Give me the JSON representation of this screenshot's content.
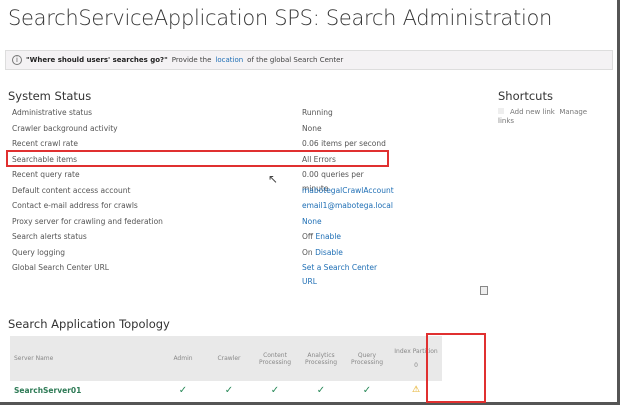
{
  "title": "SearchServiceApplication SPS: Search Administration",
  "info": {
    "icon": "info-icon",
    "question": "\"Where should users' searches go?\"",
    "pre": "Provide the",
    "link": "location",
    "post": "of the global Search Center"
  },
  "system_status": {
    "heading": "System Status",
    "rows": [
      {
        "label": "Administrative status",
        "value": "Running"
      },
      {
        "label": "Crawler background activity",
        "value": "None"
      },
      {
        "label": "Recent crawl rate",
        "value": "0.06 items per second"
      },
      {
        "label": "Searchable items",
        "value": "All Errors"
      },
      {
        "label": "Recent query rate",
        "value": "0.00 queries per minute"
      },
      {
        "label": "Default content access account",
        "link": "mabotegalCrawlAccount"
      },
      {
        "label": "Contact e-mail address for crawls",
        "link": "email1@mabotega.local"
      },
      {
        "label": "Proxy server for crawling and federation",
        "link": "None"
      },
      {
        "label": "Search alerts status",
        "value": "Off",
        "link": "Enable"
      },
      {
        "label": "Query logging",
        "value": "On",
        "link": "Disable"
      },
      {
        "label": "Global Search Center URL",
        "link": "Set a Search Center URL"
      }
    ]
  },
  "shortcuts": {
    "heading": "Shortcuts",
    "add": "Add new link",
    "manage": "Manage links"
  },
  "topology": {
    "heading": "Search Application Topology",
    "headers": [
      "Server Name",
      "Admin",
      "Crawler",
      "Content Processing",
      "Analytics Processing",
      "Query Processing",
      "Index Partition"
    ],
    "partition_index": "0",
    "rows": [
      {
        "server": "SearchServer01",
        "status": [
          "ok",
          "ok",
          "ok",
          "ok",
          "ok",
          "warning"
        ]
      }
    ]
  },
  "colors": {
    "highlight": "#e03030",
    "link": "#1f6fb5",
    "ok": "#2a8a5a",
    "warning": "#e0a000"
  }
}
